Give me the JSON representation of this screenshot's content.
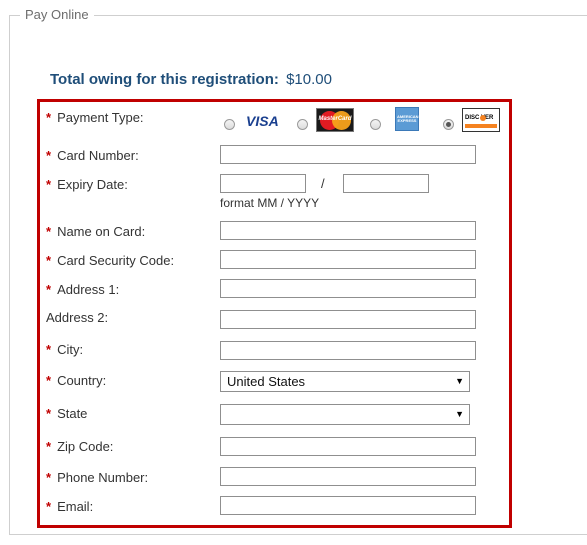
{
  "legend": "Pay Online",
  "total": {
    "label": "Total owing for this registration:",
    "amount": "$10.00"
  },
  "required_mark": "*",
  "colors": {
    "required": "#c00000",
    "form_border": "#c00000",
    "total_text": "#1f4e79"
  },
  "payment": {
    "label": "Payment Type:",
    "options": [
      {
        "name": "VISA",
        "icon": "visa-logo-icon",
        "selected": false
      },
      {
        "name": "MasterCard",
        "icon": "mastercard-logo-icon",
        "selected": false
      },
      {
        "name": "American Express",
        "icon": "amex-logo-icon",
        "selected": false
      },
      {
        "name": "DISCOVER",
        "icon": "discover-logo-icon",
        "selected": true
      }
    ],
    "visa_text": "VISA",
    "mc_text": "MasterCard",
    "amex_text": "AMERICAN EXPRESS",
    "discover_text": "DISC VER"
  },
  "fields": {
    "card_number": {
      "label": "Card Number:",
      "value": ""
    },
    "expiry": {
      "label": "Expiry Date:",
      "separator": "/",
      "hint": "format MM / YYYY",
      "month": "",
      "year": ""
    },
    "name_on_card": {
      "label": "Name on Card:",
      "value": ""
    },
    "security_code": {
      "label": "Card Security Code:",
      "value": ""
    },
    "address1": {
      "label": "Address 1:",
      "value": ""
    },
    "address2": {
      "label": "Address 2:",
      "value": ""
    },
    "city": {
      "label": "City:",
      "value": ""
    },
    "country": {
      "label": "Country:",
      "selected": "United States"
    },
    "state": {
      "label": "State",
      "selected": ""
    },
    "zip": {
      "label": "Zip Code:",
      "value": ""
    },
    "phone": {
      "label": "Phone Number:",
      "value": ""
    },
    "email": {
      "label": "Email:",
      "value": ""
    }
  }
}
